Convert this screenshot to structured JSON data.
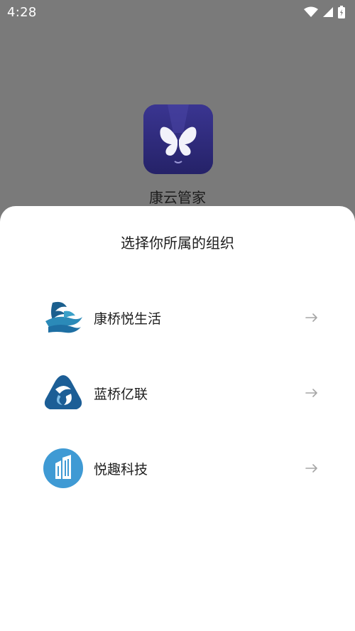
{
  "status_bar": {
    "time": "4:28",
    "icons": [
      "wifi-icon",
      "cellular-signal-icon",
      "battery-icon"
    ]
  },
  "app": {
    "name": "康云管家",
    "logo_icon": "butterfly-icon",
    "logo_color": "#2f2c80"
  },
  "sheet": {
    "title": "选择你所属的组织",
    "organizations": [
      {
        "label": "康桥悦生活",
        "logo_icon": "wave-bird-logo-icon",
        "color": "#1e6fa3"
      },
      {
        "label": "蓝桥亿联",
        "logo_icon": "triangle-swirl-logo-icon",
        "color": "#1c5e96"
      },
      {
        "label": "悦趣科技",
        "logo_icon": "building-logo-icon",
        "color": "#3f9ad4"
      }
    ],
    "arrow_icon": "arrow-right-icon"
  },
  "colors": {
    "overlay": "#7a7a7a",
    "sheet_background": "#ffffff",
    "text": "#1d1d1d",
    "arrow": "#a6a6a6"
  }
}
